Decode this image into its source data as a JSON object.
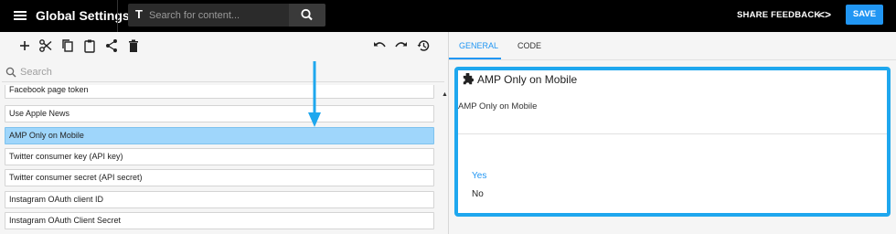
{
  "topbar": {
    "title": "Global Settings",
    "search_placeholder": "Search for content...",
    "search_prefix": "T",
    "share_feedback": "SHARE FEEDBACK",
    "code_toggle": "<>",
    "save": "SAVE",
    "save_color": "#2196f3"
  },
  "toolbar": {
    "left_icons": [
      "add-icon",
      "cut-icon",
      "copy-icon",
      "paste-icon",
      "share-icon",
      "delete-icon"
    ],
    "right_icons": [
      "undo-icon",
      "redo-icon",
      "history-icon"
    ]
  },
  "filter": {
    "placeholder": "Search"
  },
  "list": {
    "items": [
      "Facebook page token",
      "Use Apple News",
      "AMP Only on Mobile",
      "Twitter consumer key (API key)",
      "Twitter consumer secret (API secret)",
      "Instagram OAuth client ID",
      "Instagram OAuth Client Secret"
    ],
    "selected": "AMP Only on Mobile",
    "selection_color": "#9fd6fb"
  },
  "tabs": [
    {
      "label": "GENERAL",
      "active": true
    },
    {
      "label": "CODE",
      "active": false
    }
  ],
  "detail": {
    "icon": "puzzle-icon",
    "title": "AMP Only on Mobile",
    "description": "AMP Only on Mobile",
    "options": [
      "Yes",
      "No"
    ],
    "selected_option": "Yes",
    "highlight_color": "#1ea7ee"
  }
}
